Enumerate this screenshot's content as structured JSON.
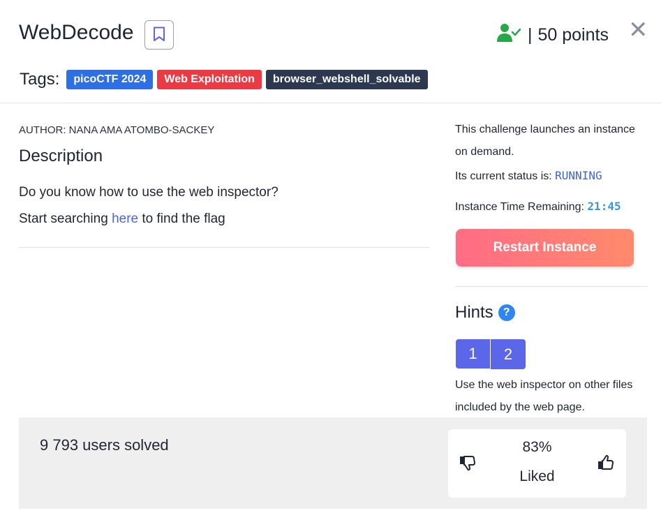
{
  "challenge": {
    "title": "WebDecode",
    "points": "50 points",
    "points_separator": "|",
    "close_glyph": "✕"
  },
  "tags": {
    "label": "Tags:",
    "items": [
      "picoCTF 2024",
      "Web Exploitation",
      "browser_webshell_solvable"
    ]
  },
  "description": {
    "author": "AUTHOR: NANA AMA ATOMBO-SACKEY",
    "heading": "Description",
    "line1": "Do you know how to use the web inspector?",
    "line2_prefix": "Start searching ",
    "line2_link": "here",
    "line2_suffix": " to find the flag"
  },
  "instance": {
    "intro": "This challenge launches an instance on demand.",
    "status_label": "Its current status is: ",
    "status_value": "RUNNING",
    "time_label": "Instance Time Remaining: ",
    "time_value": "21:45",
    "restart_label": "Restart Instance"
  },
  "hints": {
    "heading": "Hints",
    "help_glyph": "?",
    "tabs": [
      "1",
      "2"
    ],
    "text": "Use the web inspector on other files included by the web page."
  },
  "footer": {
    "solved": "9 793 users solved",
    "liked_pct": "83%",
    "liked_label": "Liked"
  },
  "colors": {
    "accent": "#5b66e9",
    "link": "#4f63e0",
    "status": "#3b63d6",
    "restart_start": "#ff6c85",
    "restart_end": "#ff8a6b",
    "solved_icon": "#28a745"
  },
  "icons": [
    "bookmark-icon",
    "user-check-icon",
    "close-icon",
    "help-icon",
    "thumbs-down-icon",
    "thumbs-up-icon"
  ]
}
